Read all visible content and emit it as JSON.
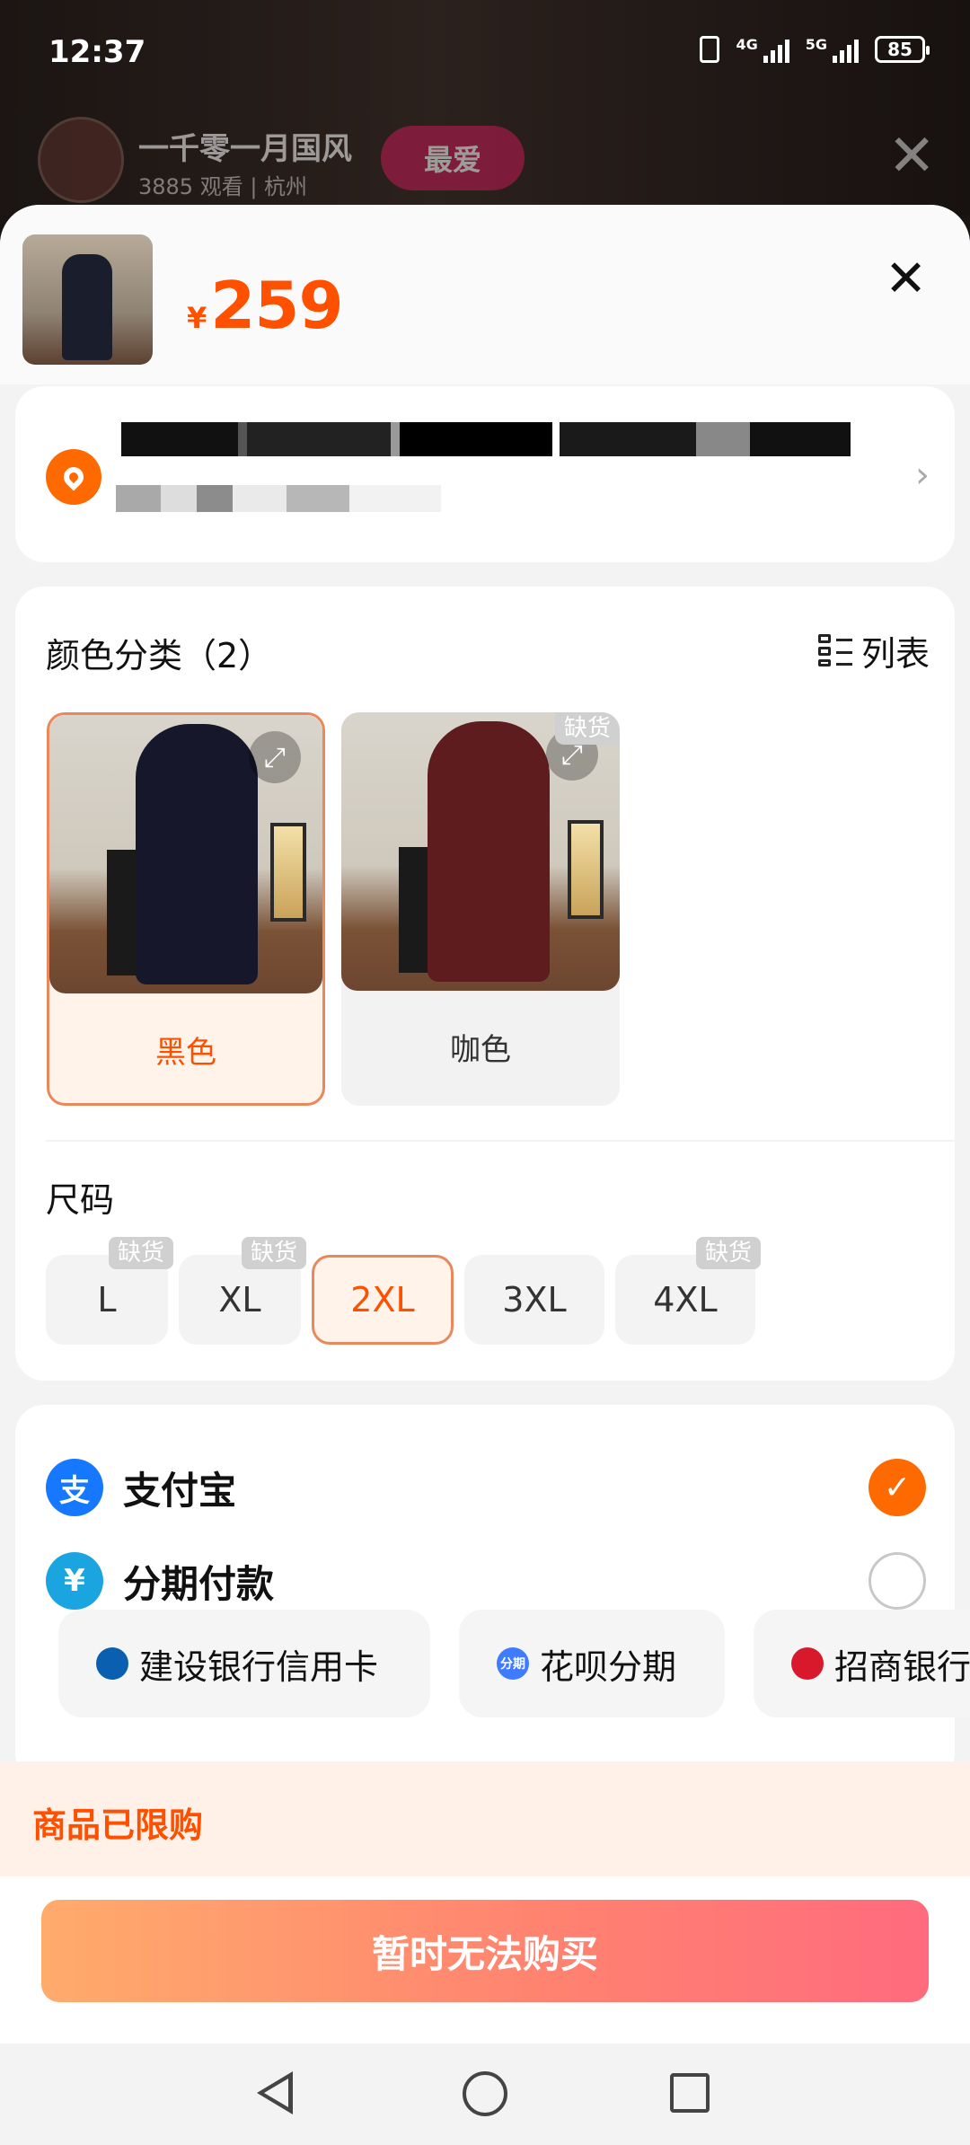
{
  "status_bar": {
    "time": "12:37",
    "network_1": "4G",
    "network_2": "5G",
    "battery": "85"
  },
  "live": {
    "shop_name": "一千零一月国风",
    "viewers": "3885 观看 | 杭州",
    "fav_label": "最爱"
  },
  "product": {
    "currency": "¥",
    "price": "259"
  },
  "sku": {
    "color_title": "颜色分类（2）",
    "list_label": "列表",
    "colors": [
      {
        "label": "黑色",
        "dress_color": "#16172a",
        "selected": true
      },
      {
        "label": "咖色",
        "dress_color": "#5e1c1f",
        "selected": false,
        "tag": "缺货"
      }
    ],
    "size_title": "尺码",
    "sizes": [
      {
        "label": "L",
        "tag": "缺货"
      },
      {
        "label": "XL",
        "tag": "缺货"
      },
      {
        "label": "2XL",
        "selected": true
      },
      {
        "label": "3XL"
      },
      {
        "label": "4XL",
        "tag": "缺货"
      }
    ]
  },
  "payment": {
    "alipay_label": "支付宝",
    "installment_label": "分期付款",
    "installments": [
      {
        "label": "建设银行信用卡"
      },
      {
        "label": "花呗分期",
        "icon_text": "分期"
      },
      {
        "label": "招商银行"
      }
    ]
  },
  "notice": "商品已限购",
  "buy_button": "暂时无法购买",
  "colors": {
    "accent": "#ff5000",
    "alipay_blue": "#1677ff"
  }
}
